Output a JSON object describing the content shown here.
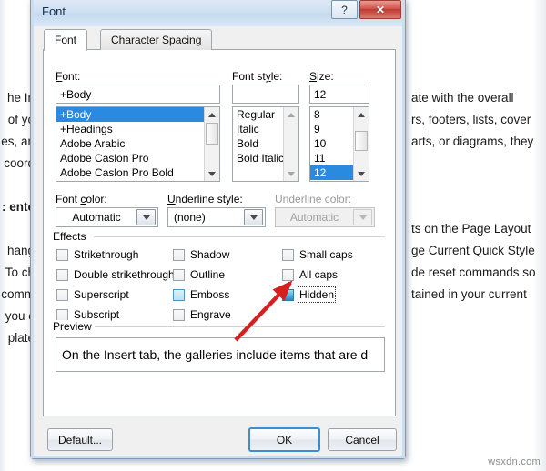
{
  "document": {
    "left_lines": [
      "he In",
      "of yo",
      "es, an",
      "coord",
      "",
      ": ente",
      "",
      "hang",
      "To ch",
      "comm",
      "you c",
      "plate"
    ],
    "right_lines": [
      "ate with the overall",
      "rs, footers, lists, cover",
      "arts, or diagrams, they",
      "",
      "",
      "",
      "ts on the Page Layout",
      "ge Current Quick Style",
      "de reset commands so",
      "tained in your current"
    ],
    "watermark": "wsxdn.com"
  },
  "dialog": {
    "title": "Font",
    "titlebar_buttons": {
      "help": "?",
      "close": "✕"
    },
    "tabs": [
      {
        "label": "Font",
        "selected": true
      },
      {
        "label": "Character Spacing",
        "selected": false
      }
    ],
    "font_section": {
      "font_label": "Font:",
      "font_input_value": "+Body",
      "font_list": [
        {
          "label": "+Body",
          "selected": true
        },
        {
          "label": "+Headings",
          "selected": false
        },
        {
          "label": "Adobe Arabic",
          "selected": false
        },
        {
          "label": "Adobe Caslon Pro",
          "selected": false
        },
        {
          "label": "Adobe Caslon Pro Bold",
          "selected": false
        }
      ],
      "style_label": "Font style:",
      "style_input_value": "",
      "style_list": [
        {
          "label": "Regular",
          "selected": false
        },
        {
          "label": "Italic",
          "selected": false
        },
        {
          "label": "Bold",
          "selected": false
        },
        {
          "label": "Bold Italic",
          "selected": false
        }
      ],
      "size_label": "Size:",
      "size_input_value": "12",
      "size_list": [
        {
          "label": "8",
          "selected": false
        },
        {
          "label": "9",
          "selected": false
        },
        {
          "label": "10",
          "selected": false
        },
        {
          "label": "11",
          "selected": false
        },
        {
          "label": "12",
          "selected": true
        }
      ]
    },
    "color_section": {
      "font_color_label": "Font color:",
      "font_color_value": "Automatic",
      "underline_style_label": "Underline style:",
      "underline_style_value": "(none)",
      "underline_color_label": "Underline color:",
      "underline_color_value": "Automatic",
      "underline_color_disabled": true
    },
    "effects": {
      "group_label": "Effects",
      "items": [
        {
          "label": "Strikethrough",
          "state": "normal",
          "focused": false
        },
        {
          "label": "Double strikethrough",
          "state": "normal",
          "focused": false
        },
        {
          "label": "Superscript",
          "state": "normal",
          "focused": false
        },
        {
          "label": "Subscript",
          "state": "normal",
          "focused": false
        },
        {
          "label": "Shadow",
          "state": "normal",
          "focused": false
        },
        {
          "label": "Outline",
          "state": "normal",
          "focused": false
        },
        {
          "label": "Emboss",
          "state": "hovered",
          "focused": false
        },
        {
          "label": "Engrave",
          "state": "normal",
          "focused": false
        },
        {
          "label": "Small caps",
          "state": "normal",
          "focused": false
        },
        {
          "label": "All caps",
          "state": "normal",
          "focused": false
        },
        {
          "label": "Hidden",
          "state": "pressed",
          "focused": true
        }
      ]
    },
    "preview": {
      "group_label": "Preview",
      "text": "On the Insert tab, the galleries include items that are d"
    },
    "buttons": {
      "default": "Default...",
      "ok": "OK",
      "cancel": "Cancel"
    }
  },
  "annotation": {
    "arrow_color": "#d42020",
    "target": "Hidden"
  }
}
